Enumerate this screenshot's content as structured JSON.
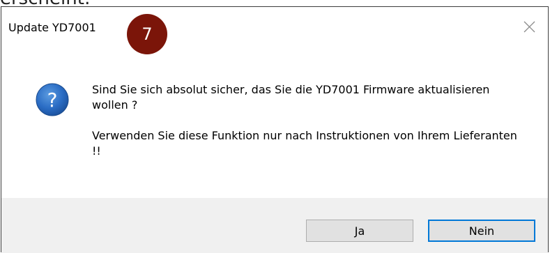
{
  "background": {
    "partial_text": "erscheint:"
  },
  "dialog": {
    "title": "Update YD7001",
    "badge": "7",
    "message_line1": "Sind Sie sich absolut sicher, das Sie die YD7001 Firmware aktualisieren wollen ?",
    "message_line2": "Verwenden Sie diese Funktion nur nach Instruktionen von Ihrem Lieferanten !!",
    "icon": "question-icon",
    "buttons": {
      "yes": "Ja",
      "no": "Nein"
    },
    "colors": {
      "badge": "#7b1509",
      "icon": "#1e5fae",
      "footer": "#f0f0f0",
      "default_button_border": "#0078d7"
    }
  }
}
